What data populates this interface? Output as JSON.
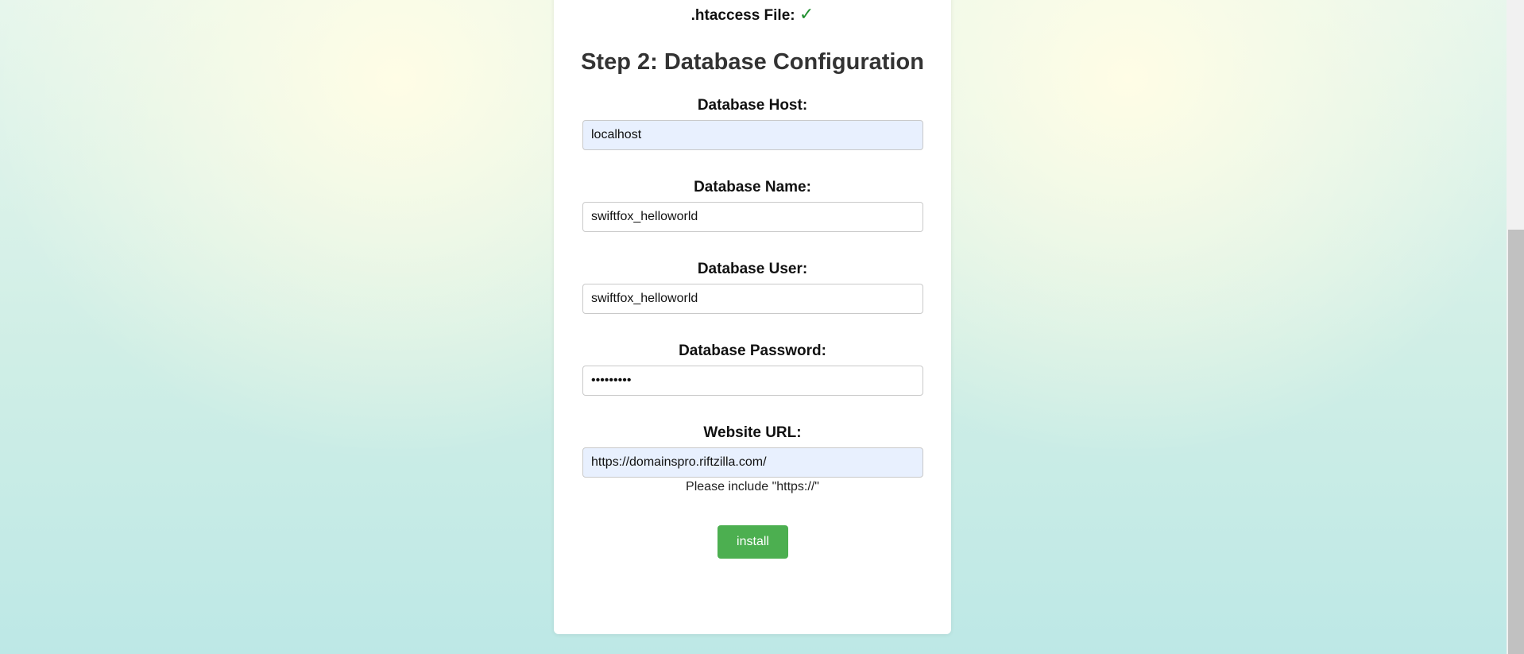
{
  "checks": {
    "htaccess_label": ".htaccess File:",
    "htaccess_status": "✓"
  },
  "step": {
    "title": "Step 2: Database Configuration"
  },
  "fields": {
    "db_host": {
      "label": "Database Host:",
      "value": "localhost"
    },
    "db_name": {
      "label": "Database Name:",
      "value": "swiftfox_helloworld"
    },
    "db_user": {
      "label": "Database User:",
      "value": "swiftfox_helloworld"
    },
    "db_password": {
      "label": "Database Password:",
      "value": "•••••••••"
    },
    "website_url": {
      "label": "Website URL:",
      "value": "https://domainspro.riftzilla.com/",
      "hint": "Please include \"https://\""
    }
  },
  "actions": {
    "install_label": "install"
  },
  "colors": {
    "install_button": "#4caf50",
    "check": "#1f8f2e",
    "autofill_bg": "#e8f0fe"
  }
}
